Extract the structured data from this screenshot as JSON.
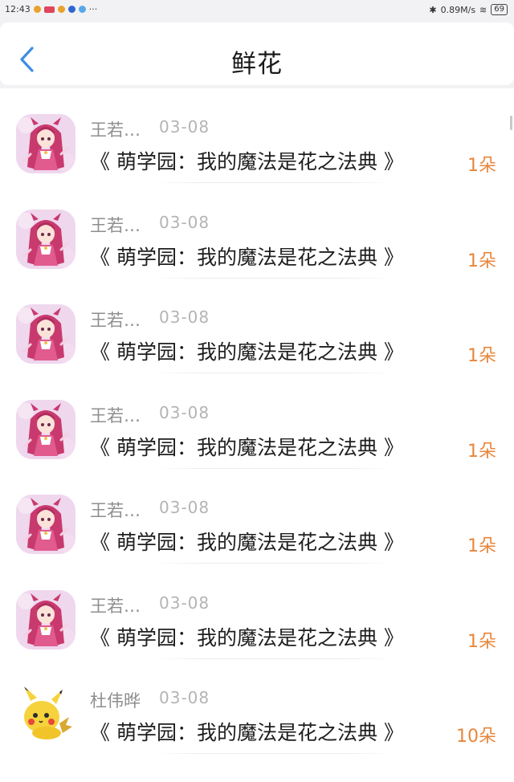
{
  "status_bar": {
    "time": "12:43",
    "left_icons": [
      "weibo-icon",
      "app-red-icon",
      "weibo-icon",
      "app-blue-icon",
      "app-lightblue-icon"
    ],
    "more": "···",
    "network_speed": "0.89M/s",
    "battery": "69"
  },
  "header": {
    "title": "鲜花"
  },
  "colors": {
    "accent_blue": "#3d8ee6",
    "count_orange": "#e8863b"
  },
  "records": [
    {
      "user": "王若…",
      "date": "03-08",
      "book": "《 萌学园：我的魔法是花之法典 》",
      "count": "1朵",
      "avatar": "anime-girl"
    },
    {
      "user": "王若…",
      "date": "03-08",
      "book": "《 萌学园：我的魔法是花之法典 》",
      "count": "1朵",
      "avatar": "anime-girl"
    },
    {
      "user": "王若…",
      "date": "03-08",
      "book": "《 萌学园：我的魔法是花之法典 》",
      "count": "1朵",
      "avatar": "anime-girl"
    },
    {
      "user": "王若…",
      "date": "03-08",
      "book": "《 萌学园：我的魔法是花之法典 》",
      "count": "1朵",
      "avatar": "anime-girl"
    },
    {
      "user": "王若…",
      "date": "03-08",
      "book": "《 萌学园：我的魔法是花之法典 》",
      "count": "1朵",
      "avatar": "anime-girl"
    },
    {
      "user": "王若…",
      "date": "03-08",
      "book": "《 萌学园：我的魔法是花之法典 》",
      "count": "1朵",
      "avatar": "anime-girl"
    },
    {
      "user": "杜伟晔",
      "date": "03-08",
      "book": "《 萌学园：我的魔法是花之法典 》",
      "count": "10朵",
      "avatar": "pikachu"
    }
  ]
}
